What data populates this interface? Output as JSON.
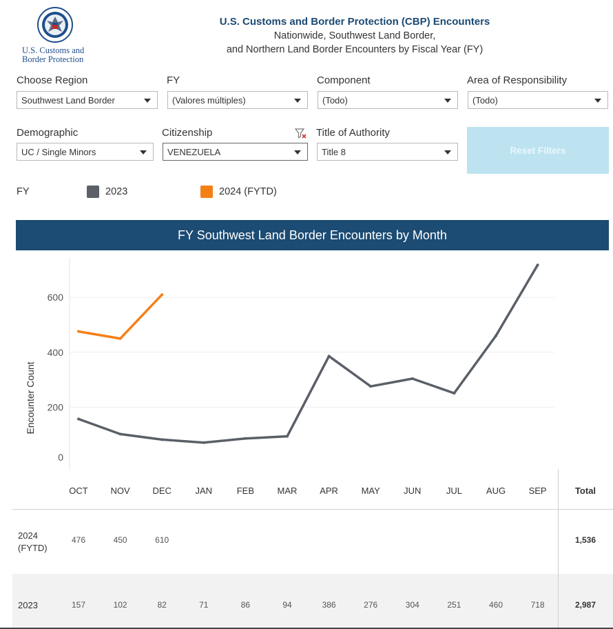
{
  "header": {
    "logo_text_line1": "U.S. Customs and",
    "logo_text_line2": "Border Protection",
    "title": "U.S. Customs and Border Protection (CBP) Encounters",
    "subtitle_line1": "Nationwide, Southwest Land Border,",
    "subtitle_line2": "and Northern Land Border Encounters by Fiscal Year (FY)"
  },
  "filters": {
    "region": {
      "label": "Choose Region",
      "value": "Southwest Land Border"
    },
    "fy": {
      "label": "FY",
      "value": "(Valores múltiples)"
    },
    "component": {
      "label": "Component",
      "value": "(Todo)"
    },
    "aor": {
      "label": "Area of Responsibility",
      "value": "(Todo)"
    },
    "demographic": {
      "label": "Demographic",
      "value": "UC / Single Minors"
    },
    "citizenship": {
      "label": "Citizenship",
      "value": "VENEZUELA"
    },
    "authority": {
      "label": "Title of Authority",
      "value": "Title 8"
    }
  },
  "reset_button": "Reset Filters",
  "legend": {
    "label": "FY",
    "items": [
      {
        "name": "2023",
        "color": "#5a5f68"
      },
      {
        "name": "2024 (FYTD)",
        "color": "#f57f17"
      }
    ]
  },
  "chart_title": "FY Southwest Land Border Encounters by Month",
  "chart_data": {
    "type": "line",
    "title": "FY Southwest Land Border Encounters by Month",
    "ylabel": "Encounter Count",
    "xlabel": "",
    "categories": [
      "OCT",
      "NOV",
      "DEC",
      "JAN",
      "FEB",
      "MAR",
      "APR",
      "MAY",
      "JUN",
      "JUL",
      "AUG",
      "SEP"
    ],
    "yticks": [
      0,
      200,
      400,
      600
    ],
    "ylim": [
      0,
      750
    ],
    "grid": true,
    "series": [
      {
        "name": "2023",
        "color": "#5a5f68",
        "values": [
          157,
          102,
          82,
          71,
          86,
          94,
          386,
          276,
          304,
          251,
          460,
          718
        ]
      },
      {
        "name": "2024 (FYTD)",
        "color": "#f57f17",
        "values": [
          476,
          450,
          610
        ]
      }
    ]
  },
  "table": {
    "total_header": "Total",
    "rows": [
      {
        "label": "2024\n(FYTD)",
        "values": [
          "476",
          "450",
          "610",
          "",
          "",
          "",
          "",
          "",
          "",
          "",
          "",
          ""
        ],
        "total": "1,536"
      },
      {
        "label": "2023",
        "values": [
          "157",
          "102",
          "82",
          "71",
          "86",
          "94",
          "386",
          "276",
          "304",
          "251",
          "460",
          "718"
        ],
        "total": "2,987"
      }
    ]
  }
}
